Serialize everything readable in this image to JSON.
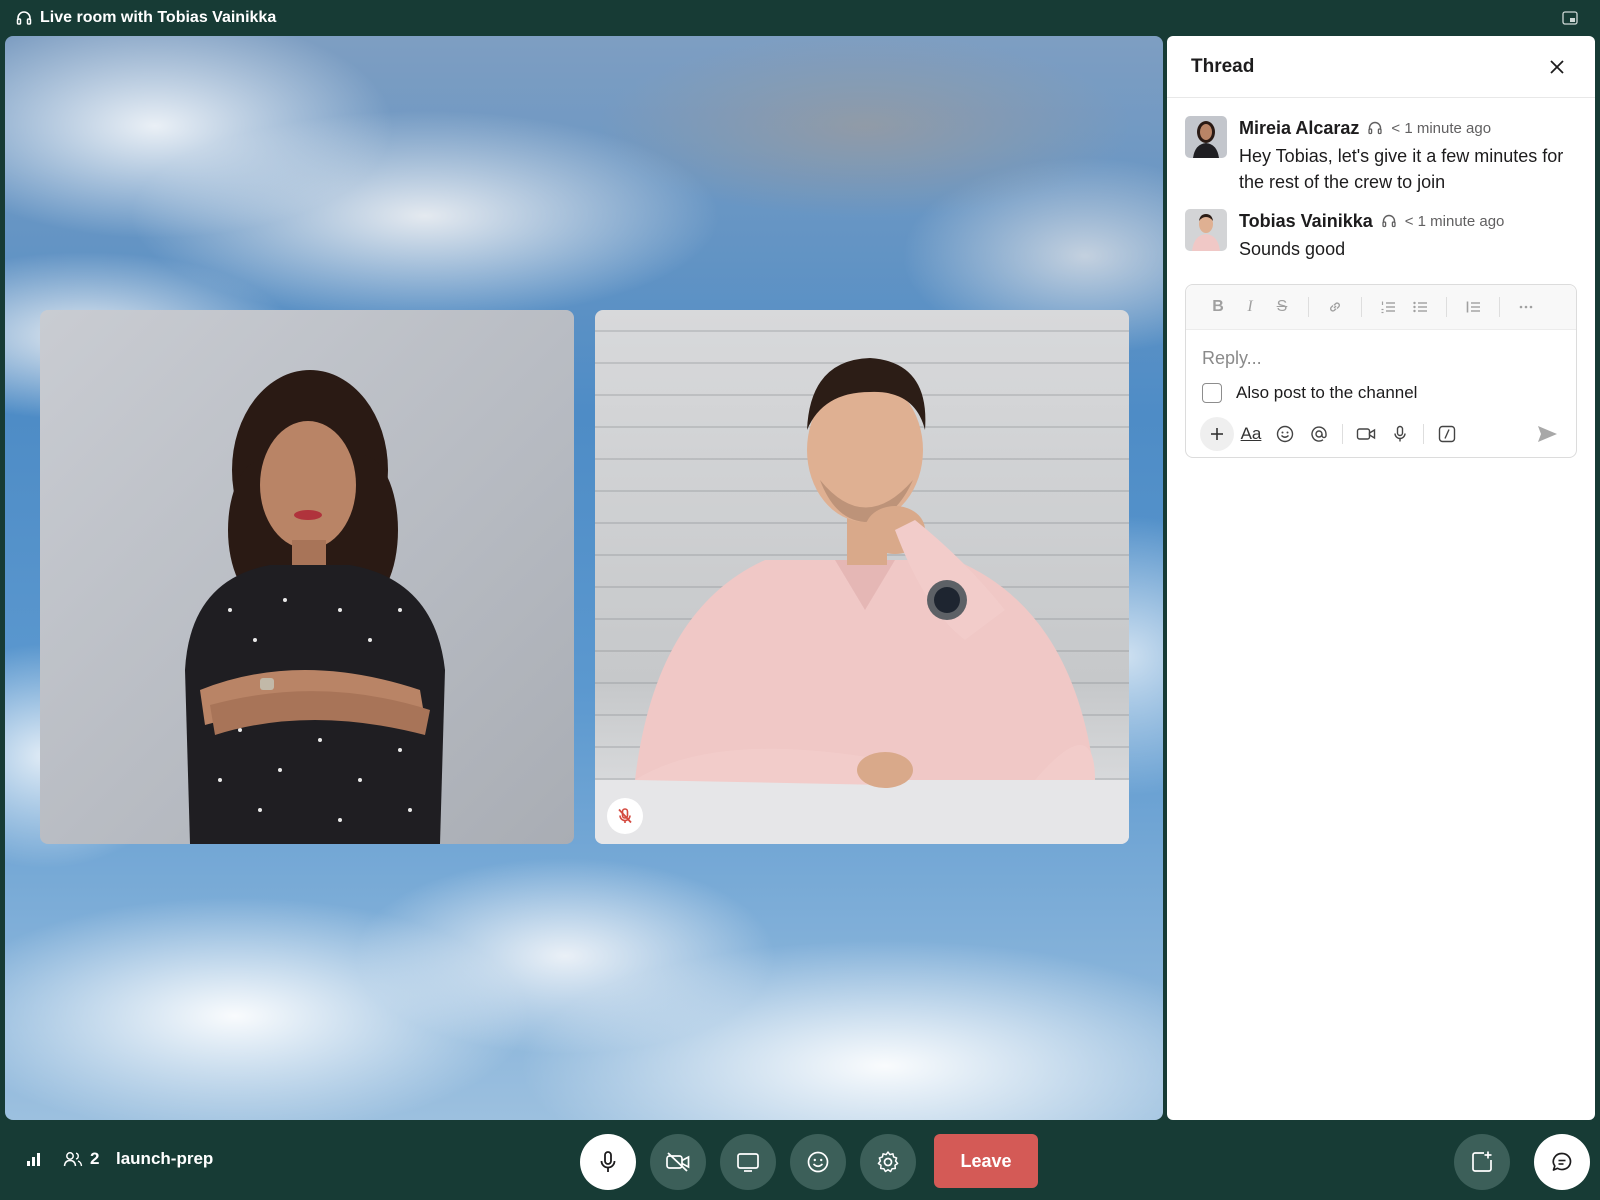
{
  "window": {
    "title": "Live room with Tobias Vainikka",
    "headphones_icon": "headphones-icon",
    "popout_icon": "popout-window-icon"
  },
  "stage": {
    "participants": [
      {
        "name": "Mireia Alcaraz",
        "muted": false
      },
      {
        "name": "Tobias Vainikka",
        "muted": true
      }
    ],
    "muted_icon": "mic-off-icon"
  },
  "thread": {
    "title": "Thread",
    "close_icon": "close-icon",
    "messages": [
      {
        "author": "Mireia Alcaraz",
        "time": "< 1 minute ago",
        "text": "Hey Tobias, let's give it a few minutes for the rest of the crew to join"
      },
      {
        "author": "Tobias Vainikka",
        "time": "< 1 minute ago",
        "text": "Sounds good"
      }
    ],
    "composer": {
      "format_buttons": [
        "bold",
        "italic",
        "strikethrough",
        "link",
        "ordered-list",
        "bulleted-list",
        "blockquote",
        "more"
      ],
      "placeholder": "Reply...",
      "also_post_label": "Also post to the channel",
      "also_post_checked": false,
      "aa_label": "Aa",
      "tools": [
        "plus",
        "format",
        "emoji",
        "mention",
        "video",
        "audio",
        "shortcuts"
      ],
      "send_icon": "send-icon"
    }
  },
  "bottom_bar": {
    "participant_count": "2",
    "channel": "launch-prep",
    "controls": [
      "microphone",
      "camera-off",
      "share-screen",
      "reactions",
      "settings"
    ],
    "leave_label": "Leave",
    "right_controls": [
      "new-huddle-window",
      "thread"
    ]
  },
  "colors": {
    "background": "#173b35",
    "control": "#3c5f59",
    "leave": "#d45a56",
    "muted": "#d4493f"
  }
}
